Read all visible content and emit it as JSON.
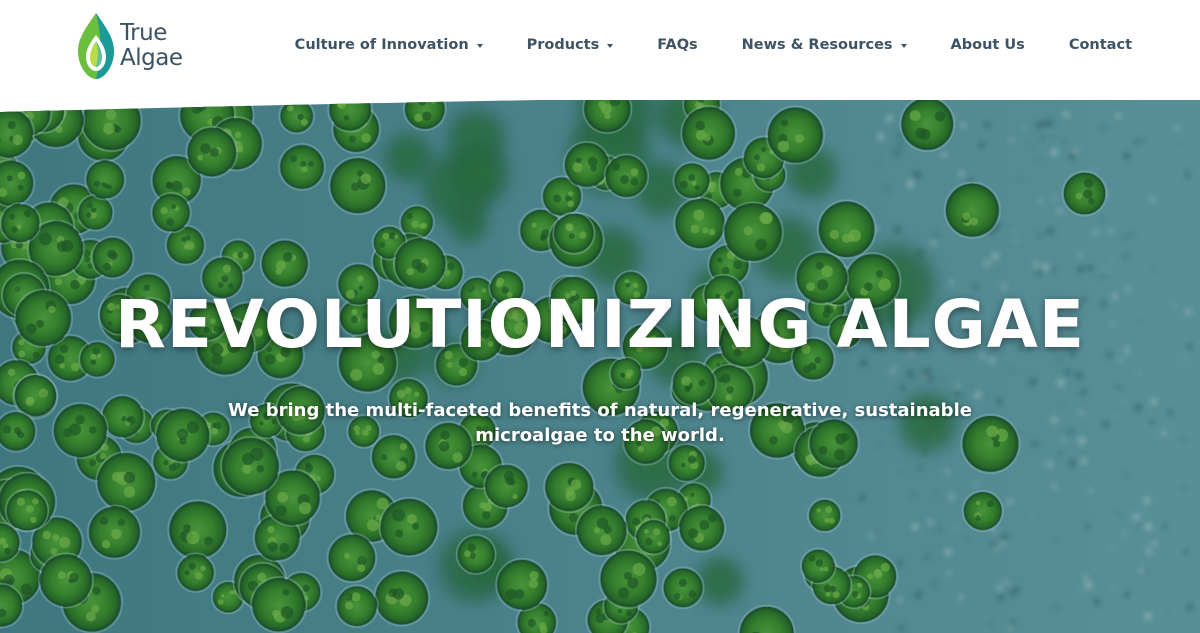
{
  "brand": {
    "name_line1": "True",
    "name_line2": "Algae",
    "colors": {
      "text": "#3b5262",
      "leaf_green": "#6cbf3e",
      "leaf_teal": "#1c9a9a",
      "leaf_light": "#b9dc46"
    }
  },
  "nav": {
    "items": [
      {
        "label": "Culture of Innovation",
        "has_dropdown": true,
        "icon": "chevron-down-icon"
      },
      {
        "label": "Products",
        "has_dropdown": true,
        "icon": "chevron-down-icon"
      },
      {
        "label": "FAQs",
        "has_dropdown": false
      },
      {
        "label": "News & Resources",
        "has_dropdown": true,
        "icon": "chevron-down-icon"
      },
      {
        "label": "About Us",
        "has_dropdown": false
      },
      {
        "label": "Contact",
        "has_dropdown": false
      }
    ]
  },
  "hero": {
    "title": "REVOLUTIONIZING ALGAE",
    "subtitle": "We bring the multi-faceted benefits of natural, regenerative, sustainable microalgae to the world.",
    "background_image": "microscope view of green microalgae cells on a teal background",
    "colors": {
      "background": "#4d8a96",
      "cell": "#3f8f2c"
    }
  }
}
